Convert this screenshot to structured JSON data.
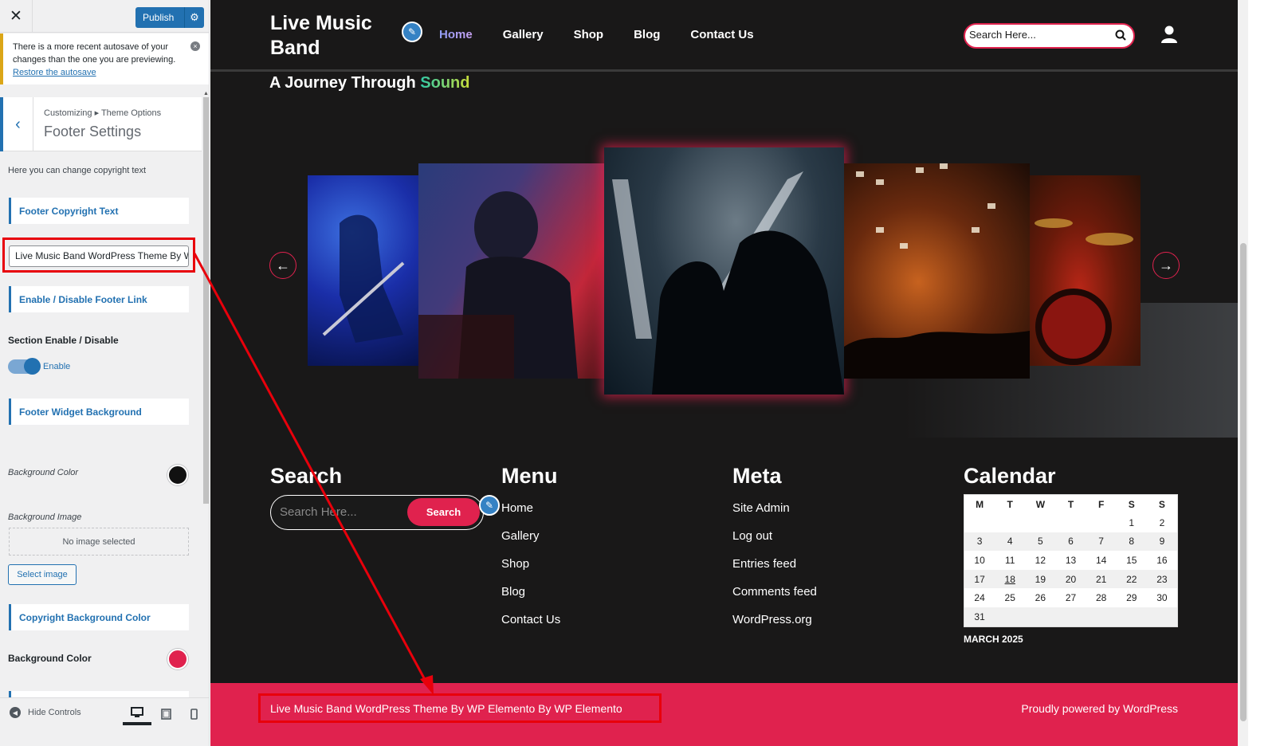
{
  "customizer": {
    "close_icon": "close-icon",
    "publish_label": "Publish",
    "notice": {
      "text": "There is a more recent autosave of your changes than the one you are previewing.",
      "link": "Restore the autosave",
      "dismiss": "×"
    },
    "breadcrumb": "Customizing ▸ Theme Options",
    "section_title": "Footer Settings",
    "description": "Here you can change copyright text",
    "footer_copyright_heading": "Footer Copyright Text",
    "footer_copyright_value": "Live Music Band WordPress Theme By WP Elemento",
    "footer_link_heading": "Enable / Disable Footer Link",
    "section_toggle_label": "Section Enable / Disable",
    "toggle_state_label": "Enable",
    "widget_bg_heading": "Footer Widget Background",
    "widget_bg_color_label": "Background Color",
    "widget_bg_color": "#111111",
    "widget_bg_image_label": "Background Image",
    "no_image_label": "No image selected",
    "select_image_label": "Select image",
    "copyright_bg_heading": "Copyright Background Color",
    "copyright_bg_color_label": "Background Color",
    "copyright_bg_color": "#e0224e",
    "hide_controls_label": "Hide Controls"
  },
  "site": {
    "title": "Live Music Band",
    "nav": [
      "Home",
      "Gallery",
      "Shop",
      "Blog",
      "Contact Us"
    ],
    "active_nav": "Home",
    "search_placeholder": "Search Here...",
    "section_heading_prefix": "A Journey Through ",
    "section_heading_accent": "Sound",
    "accent_color": "#e0224e"
  },
  "footer_widgets": {
    "search": {
      "title": "Search",
      "placeholder": "Search Here...",
      "button": "Search"
    },
    "menu": {
      "title": "Menu",
      "items": [
        "Home",
        "Gallery",
        "Shop",
        "Blog",
        "Contact Us"
      ]
    },
    "meta": {
      "title": "Meta",
      "items": [
        "Site Admin",
        "Log out",
        "Entries feed",
        "Comments feed",
        "WordPress.org"
      ]
    },
    "calendar": {
      "title": "Calendar",
      "weekdays": [
        "M",
        "T",
        "W",
        "T",
        "F",
        "S",
        "S"
      ],
      "weeks": [
        [
          "",
          "",
          "",
          "",
          "",
          "1",
          "2"
        ],
        [
          "3",
          "4",
          "5",
          "6",
          "7",
          "8",
          "9"
        ],
        [
          "10",
          "11",
          "12",
          "13",
          "14",
          "15",
          "16"
        ],
        [
          "17",
          "18",
          "19",
          "20",
          "21",
          "22",
          "23"
        ],
        [
          "24",
          "25",
          "26",
          "27",
          "28",
          "29",
          "30"
        ],
        [
          "31",
          "",
          "",
          "",
          "",
          "",
          ""
        ]
      ],
      "today": "18",
      "caption": "MARCH 2025"
    }
  },
  "copyright": {
    "text": "Live Music Band WordPress Theme By WP Elemento By WP Elemento",
    "powered": "Proudly powered by WordPress"
  }
}
